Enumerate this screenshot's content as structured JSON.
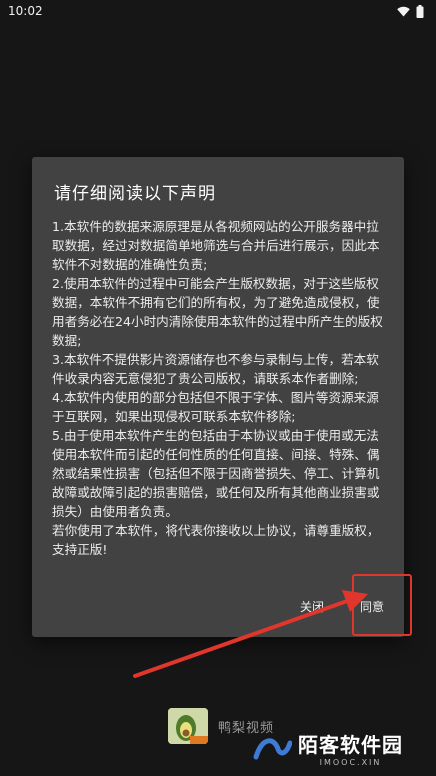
{
  "status_bar": {
    "time": "10:02",
    "icons": [
      "wifi-icon",
      "battery-icon"
    ]
  },
  "dialog": {
    "title": "请仔细阅读以下声明",
    "body": "1.本软件的数据来源原理是从各视频网站的公开服务器中拉取数据，经过对数据简单地筛选与合并后进行展示，因此本软件不对数据的准确性负责;\n2.使用本软件的过程中可能会产生版权数据，对于这些版权数据，本软件不拥有它们的所有权，为了避免造成侵权，使用者务必在24小时内清除使用本软件的过程中所产生的版权数据;\n3.本软件不提供影片资源储存也不参与录制与上传，若本软件收录内容无意侵犯了贵公司版权，请联系本作者删除;\n4.本软件内使用的部分包括但不限于字体、图片等资源来源于互联网，如果出现侵权可联系本软件移除;\n5.由于使用本软件产生的包括由于本协议或由于使用或无法使用本软件而引起的任何性质的任何直接、间接、特殊、偶然或结果性损害（包括但不限于因商誉损失、停工、计算机故障或故障引起的损害赔偿，或任何及所有其他商业损害或损失）由使用者负责。\n若你使用了本软件，将代表你接收以上协议，请尊重版权，支持正版!",
    "close_label": "关闭",
    "agree_label": "同意"
  },
  "annotation": {
    "color": "#e0362c"
  },
  "background_app": {
    "name": "鸭梨视频",
    "icon": "avocado-app-icon"
  },
  "watermark": {
    "title": "陌客软件园",
    "subtitle": "IMOOC.XIN"
  }
}
